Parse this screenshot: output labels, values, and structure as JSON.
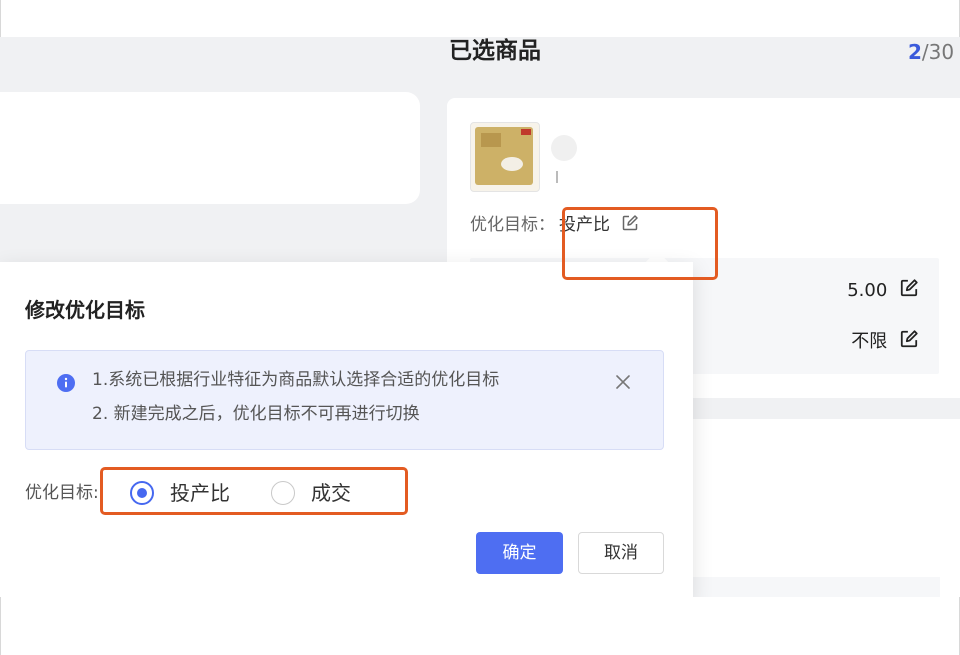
{
  "selected_panel": {
    "title": "已选商品",
    "count_current": "2",
    "count_total": "/30"
  },
  "product": {
    "opt_goal_label": "优化目标：",
    "opt_goal_value": "投产比",
    "bid_value": "5.00",
    "limit_value": "不限"
  },
  "popover": {
    "title": "修改优化目标",
    "tip_line1": "1.系统已根据行业特征为商品默认选择合适的优化目标",
    "tip_line2": "2. 新建完成之后，优化目标不可再进行切换",
    "goal_label": "优化目标:",
    "options": [
      {
        "label": "投产比",
        "checked": true
      },
      {
        "label": "成交",
        "checked": false
      }
    ],
    "confirm_label": "确定",
    "cancel_label": "取消"
  },
  "colors": {
    "accent": "#4e6ef2",
    "highlight": "#e35b22",
    "tip_bg": "#eef1fd"
  },
  "icons": {
    "edit": "edit-icon",
    "info": "info-icon",
    "close": "close-icon"
  }
}
